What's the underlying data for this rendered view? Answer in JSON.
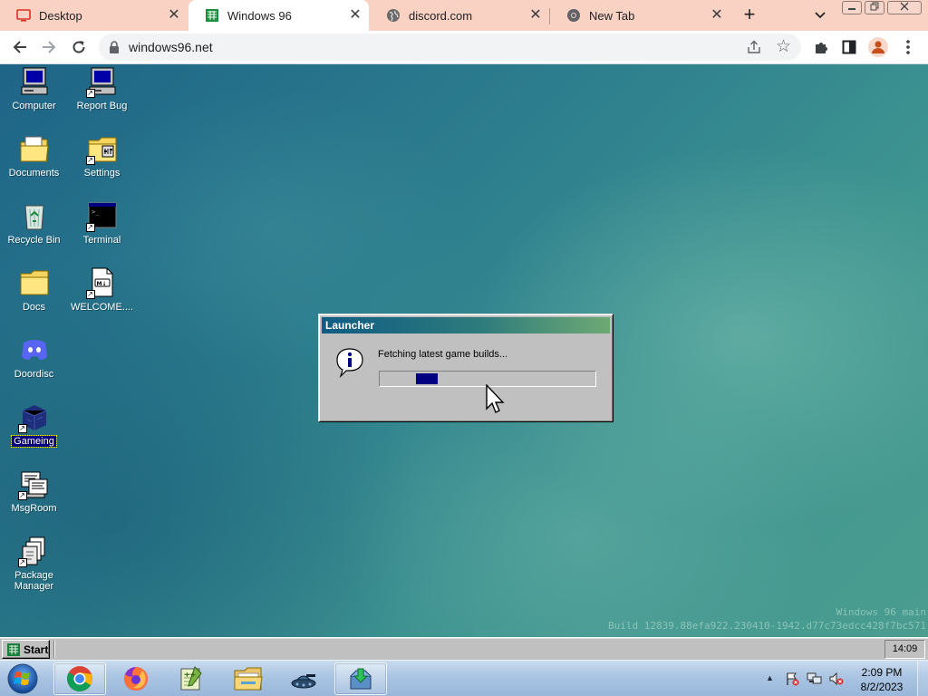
{
  "browser": {
    "tabs": [
      {
        "title": "Desktop",
        "icon": "desktop-icon",
        "active": false
      },
      {
        "title": "Windows 96",
        "icon": "windows96-icon",
        "active": true
      },
      {
        "title": "discord.com",
        "icon": "globe-icon",
        "active": false
      },
      {
        "title": "New Tab",
        "icon": "chrome-icon",
        "active": false
      }
    ],
    "tab_close_glyph": "✕",
    "new_tab_glyph": "+",
    "tab_list_glyph": "⌄",
    "url": "windows96.net",
    "profile_color": "#c5501e"
  },
  "desktop": {
    "icons": [
      {
        "label": "Computer",
        "icon": "computer-icon"
      },
      {
        "label": "Report Bug",
        "icon": "report-bug-icon"
      },
      {
        "label": "Documents",
        "icon": "documents-folder-icon"
      },
      {
        "label": "Settings",
        "icon": "settings-icon"
      },
      {
        "label": "Recycle Bin",
        "icon": "recycle-bin-icon"
      },
      {
        "label": "Terminal",
        "icon": "terminal-icon"
      },
      {
        "label": "Docs",
        "icon": "docs-folder-icon"
      },
      {
        "label": "WELCOME....",
        "icon": "markdown-file-icon"
      },
      {
        "label": "Doordisc",
        "icon": "doordisc-icon"
      },
      {
        "label": "Gameing",
        "icon": "gameing-icon",
        "selected": true
      },
      {
        "label": "MsgRoom",
        "icon": "msgroom-icon"
      },
      {
        "label": "Package Manager",
        "icon": "package-manager-icon"
      }
    ],
    "build_line1": "Windows 96 main",
    "build_line2": "Build 12839.88efa922.230410-1942.d77c73edcc428f7bc571"
  },
  "launcher": {
    "title": "Launcher",
    "message": "Fetching latest game builds...",
    "progress_state": "indeterminate"
  },
  "w96_taskbar": {
    "start_label": "Start",
    "clock": "14:09"
  },
  "w7_taskbar": {
    "pinned": [
      {
        "name": "chrome",
        "running": true
      },
      {
        "name": "firefox",
        "running": false
      },
      {
        "name": "notepad-plus",
        "running": false
      },
      {
        "name": "file-explorer",
        "running": false
      },
      {
        "name": "tank-game",
        "running": false
      },
      {
        "name": "installer",
        "running": true
      }
    ],
    "time": "2:09 PM",
    "date": "8/2/2023",
    "tray_arrow": "▲"
  },
  "colors": {
    "titlebar_start": "#0f5c84",
    "titlebar_end": "#6ea974",
    "progress_fill": "#000080",
    "tab_strip": "#f9d2c4"
  }
}
